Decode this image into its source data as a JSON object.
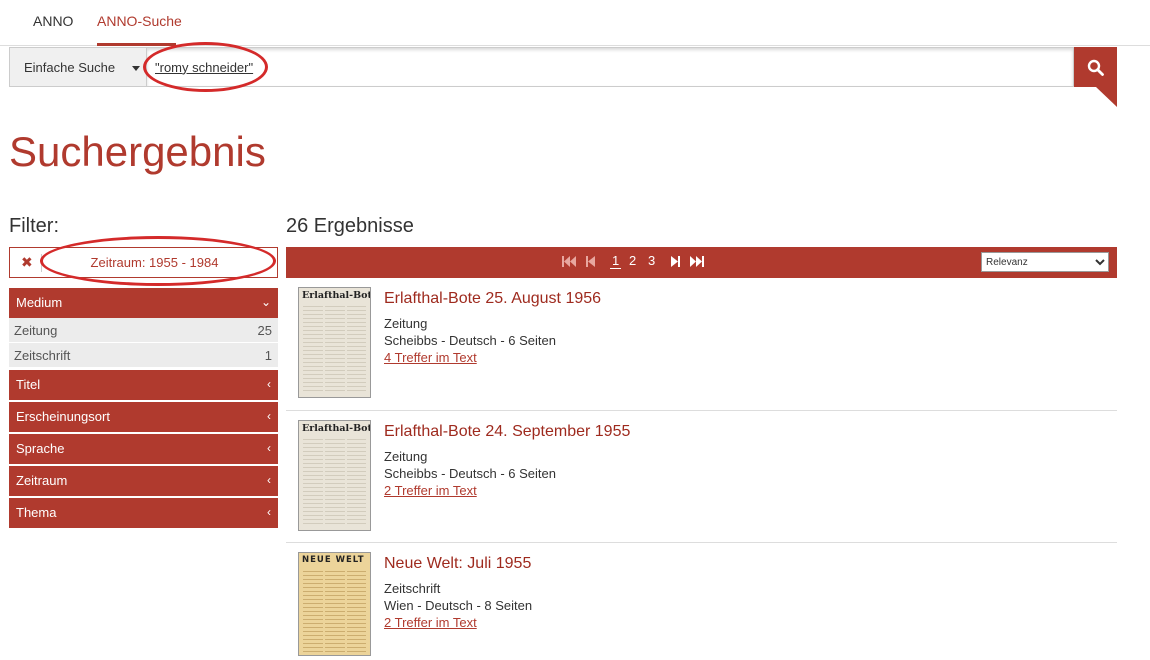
{
  "nav": {
    "tabs": [
      {
        "label": "ANNO"
      },
      {
        "label": "ANNO-Suche"
      }
    ]
  },
  "search": {
    "mode": "Einfache Suche",
    "query": "\"romy schneider\""
  },
  "page_title": "Suchergebnis",
  "filter": {
    "title": "Filter:",
    "active": "Zeitraum: 1955 - 1984",
    "facets": [
      {
        "label": "Medium",
        "expanded": true,
        "items": [
          {
            "label": "Zeitung",
            "count": "25"
          },
          {
            "label": "Zeitschrift",
            "count": "1"
          }
        ]
      },
      {
        "label": "Titel"
      },
      {
        "label": "Erscheinungsort"
      },
      {
        "label": "Sprache"
      },
      {
        "label": "Zeitraum"
      },
      {
        "label": "Thema"
      }
    ]
  },
  "results": {
    "count_label": "26 Ergebnisse",
    "pages": [
      "1",
      "2",
      "3"
    ],
    "sort": "Relevanz",
    "items": [
      {
        "title": "Erlafthal-Bote 25. August 1956",
        "type": "Zeitung",
        "meta": "Scheibbs - Deutsch - 6 Seiten",
        "hits": "4 Treffer im Text",
        "masthead": "Erlafthal-Bote"
      },
      {
        "title": "Erlafthal-Bote 24. September 1955",
        "type": "Zeitung",
        "meta": "Scheibbs - Deutsch - 6 Seiten",
        "hits": "2 Treffer im Text",
        "masthead": "Erlafthal-Bote"
      },
      {
        "title": "Neue Welt: Juli 1955",
        "type": "Zeitschrift",
        "meta": "Wien - Deutsch - 8 Seiten",
        "hits": "2 Treffer im Text",
        "masthead": "NEUE WELT"
      }
    ]
  },
  "colors": {
    "accent": "#b03a2e",
    "annotation": "#d42a2a"
  }
}
